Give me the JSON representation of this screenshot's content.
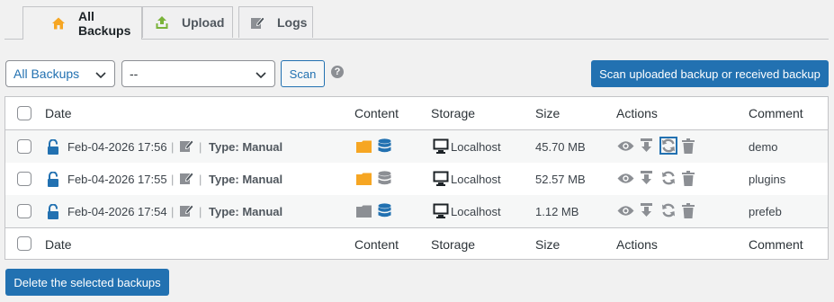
{
  "tabs": [
    {
      "label": "All Backups",
      "icon": "home-icon",
      "active": true
    },
    {
      "label": "Upload",
      "icon": "upload-icon",
      "active": false
    },
    {
      "label": "Logs",
      "icon": "edit-icon",
      "active": false
    }
  ],
  "toolbar": {
    "filter_select": "All Backups",
    "secondary_select": "--",
    "scan_label": "Scan",
    "help_label": "?",
    "scan_uploaded_label": "Scan uploaded backup or received backup"
  },
  "table": {
    "headers": {
      "date": "Date",
      "content": "Content",
      "storage": "Storage",
      "size": "Size",
      "actions": "Actions",
      "comment": "Comment"
    },
    "rows": [
      {
        "date": "Feb-04-2026 17:56",
        "type": "Type: Manual",
        "storage": "Localhost",
        "size": "45.70 MB",
        "comment": "demo",
        "content_files": true,
        "content_db": true
      },
      {
        "date": "Feb-04-2026 17:55",
        "type": "Type: Manual",
        "storage": "Localhost",
        "size": "52.57 MB",
        "comment": "plugins",
        "content_files": true,
        "content_db": false
      },
      {
        "date": "Feb-04-2026 17:54",
        "type": "Type: Manual",
        "storage": "Localhost",
        "size": "1.12 MB",
        "comment": "prefeb",
        "content_files": false,
        "content_db": true
      }
    ],
    "separator": "|"
  },
  "footer": {
    "delete_label": "Delete the selected backups"
  },
  "colors": {
    "accent": "#2271b1",
    "folder_active": "#f6a623",
    "db_active": "#2271b1",
    "icon_inactive": "#8c8f94",
    "lock": "#2271b1"
  }
}
